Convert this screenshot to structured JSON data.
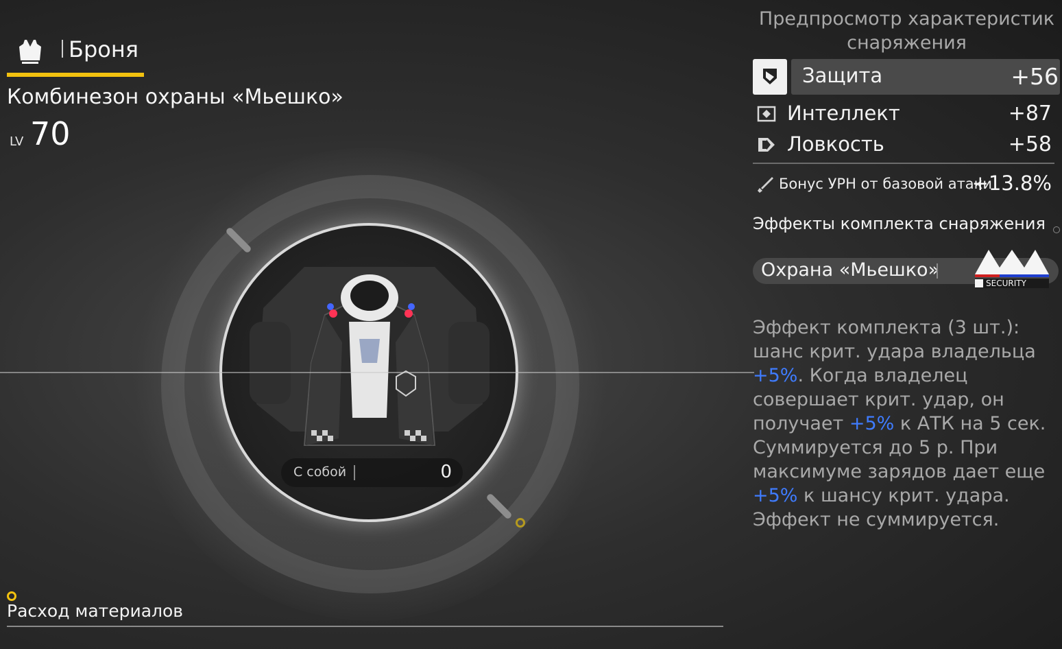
{
  "header": {
    "category_icon": "armor-icon",
    "category_label": "Броня",
    "item_name": "Комбинезон охраны «Мьешко»",
    "level_prefix": "LV",
    "level_value": "70"
  },
  "showcase": {
    "equip_label": "С собой",
    "equip_value": "0"
  },
  "footer": {
    "materials_label": "Расход материалов"
  },
  "stats_panel": {
    "title_line1": "Предпросмотр характеристик",
    "title_line2": "снаряжения",
    "stats": [
      {
        "name": "Защита",
        "value": "+56",
        "icon": "shield-icon"
      },
      {
        "name": "Интеллект",
        "value": "+87",
        "icon": "intellect-icon"
      },
      {
        "name": "Ловкость",
        "value": "+58",
        "icon": "agility-icon"
      }
    ],
    "bonus": {
      "name": "Бонус УРН от базовой атаки",
      "value": "+13.8%",
      "icon": "sword-icon"
    },
    "set_effects_title": "Эффекты комплекта снаряжения",
    "set_name": "Охрана «Мьешко»",
    "set_logo_text": "SECURITY",
    "set_desc": {
      "p1": "Эффект комплекта (3 шт.): шанс крит. удара владельца ",
      "h1": "+5%",
      "p2": ". Когда владелец совершает крит. удар, он получает ",
      "h2": "+5%",
      "p3": " к АТК на 5 сек. Суммируется до 5 р. При максимуме зарядов дает еще ",
      "h3": "+5%",
      "p4": " к шансу крит. удара. Эффект не суммируется."
    }
  },
  "colors": {
    "accent_yellow": "#f2c10f",
    "highlight_blue": "#3f7cff",
    "muted_text": "#a9a9a9"
  }
}
